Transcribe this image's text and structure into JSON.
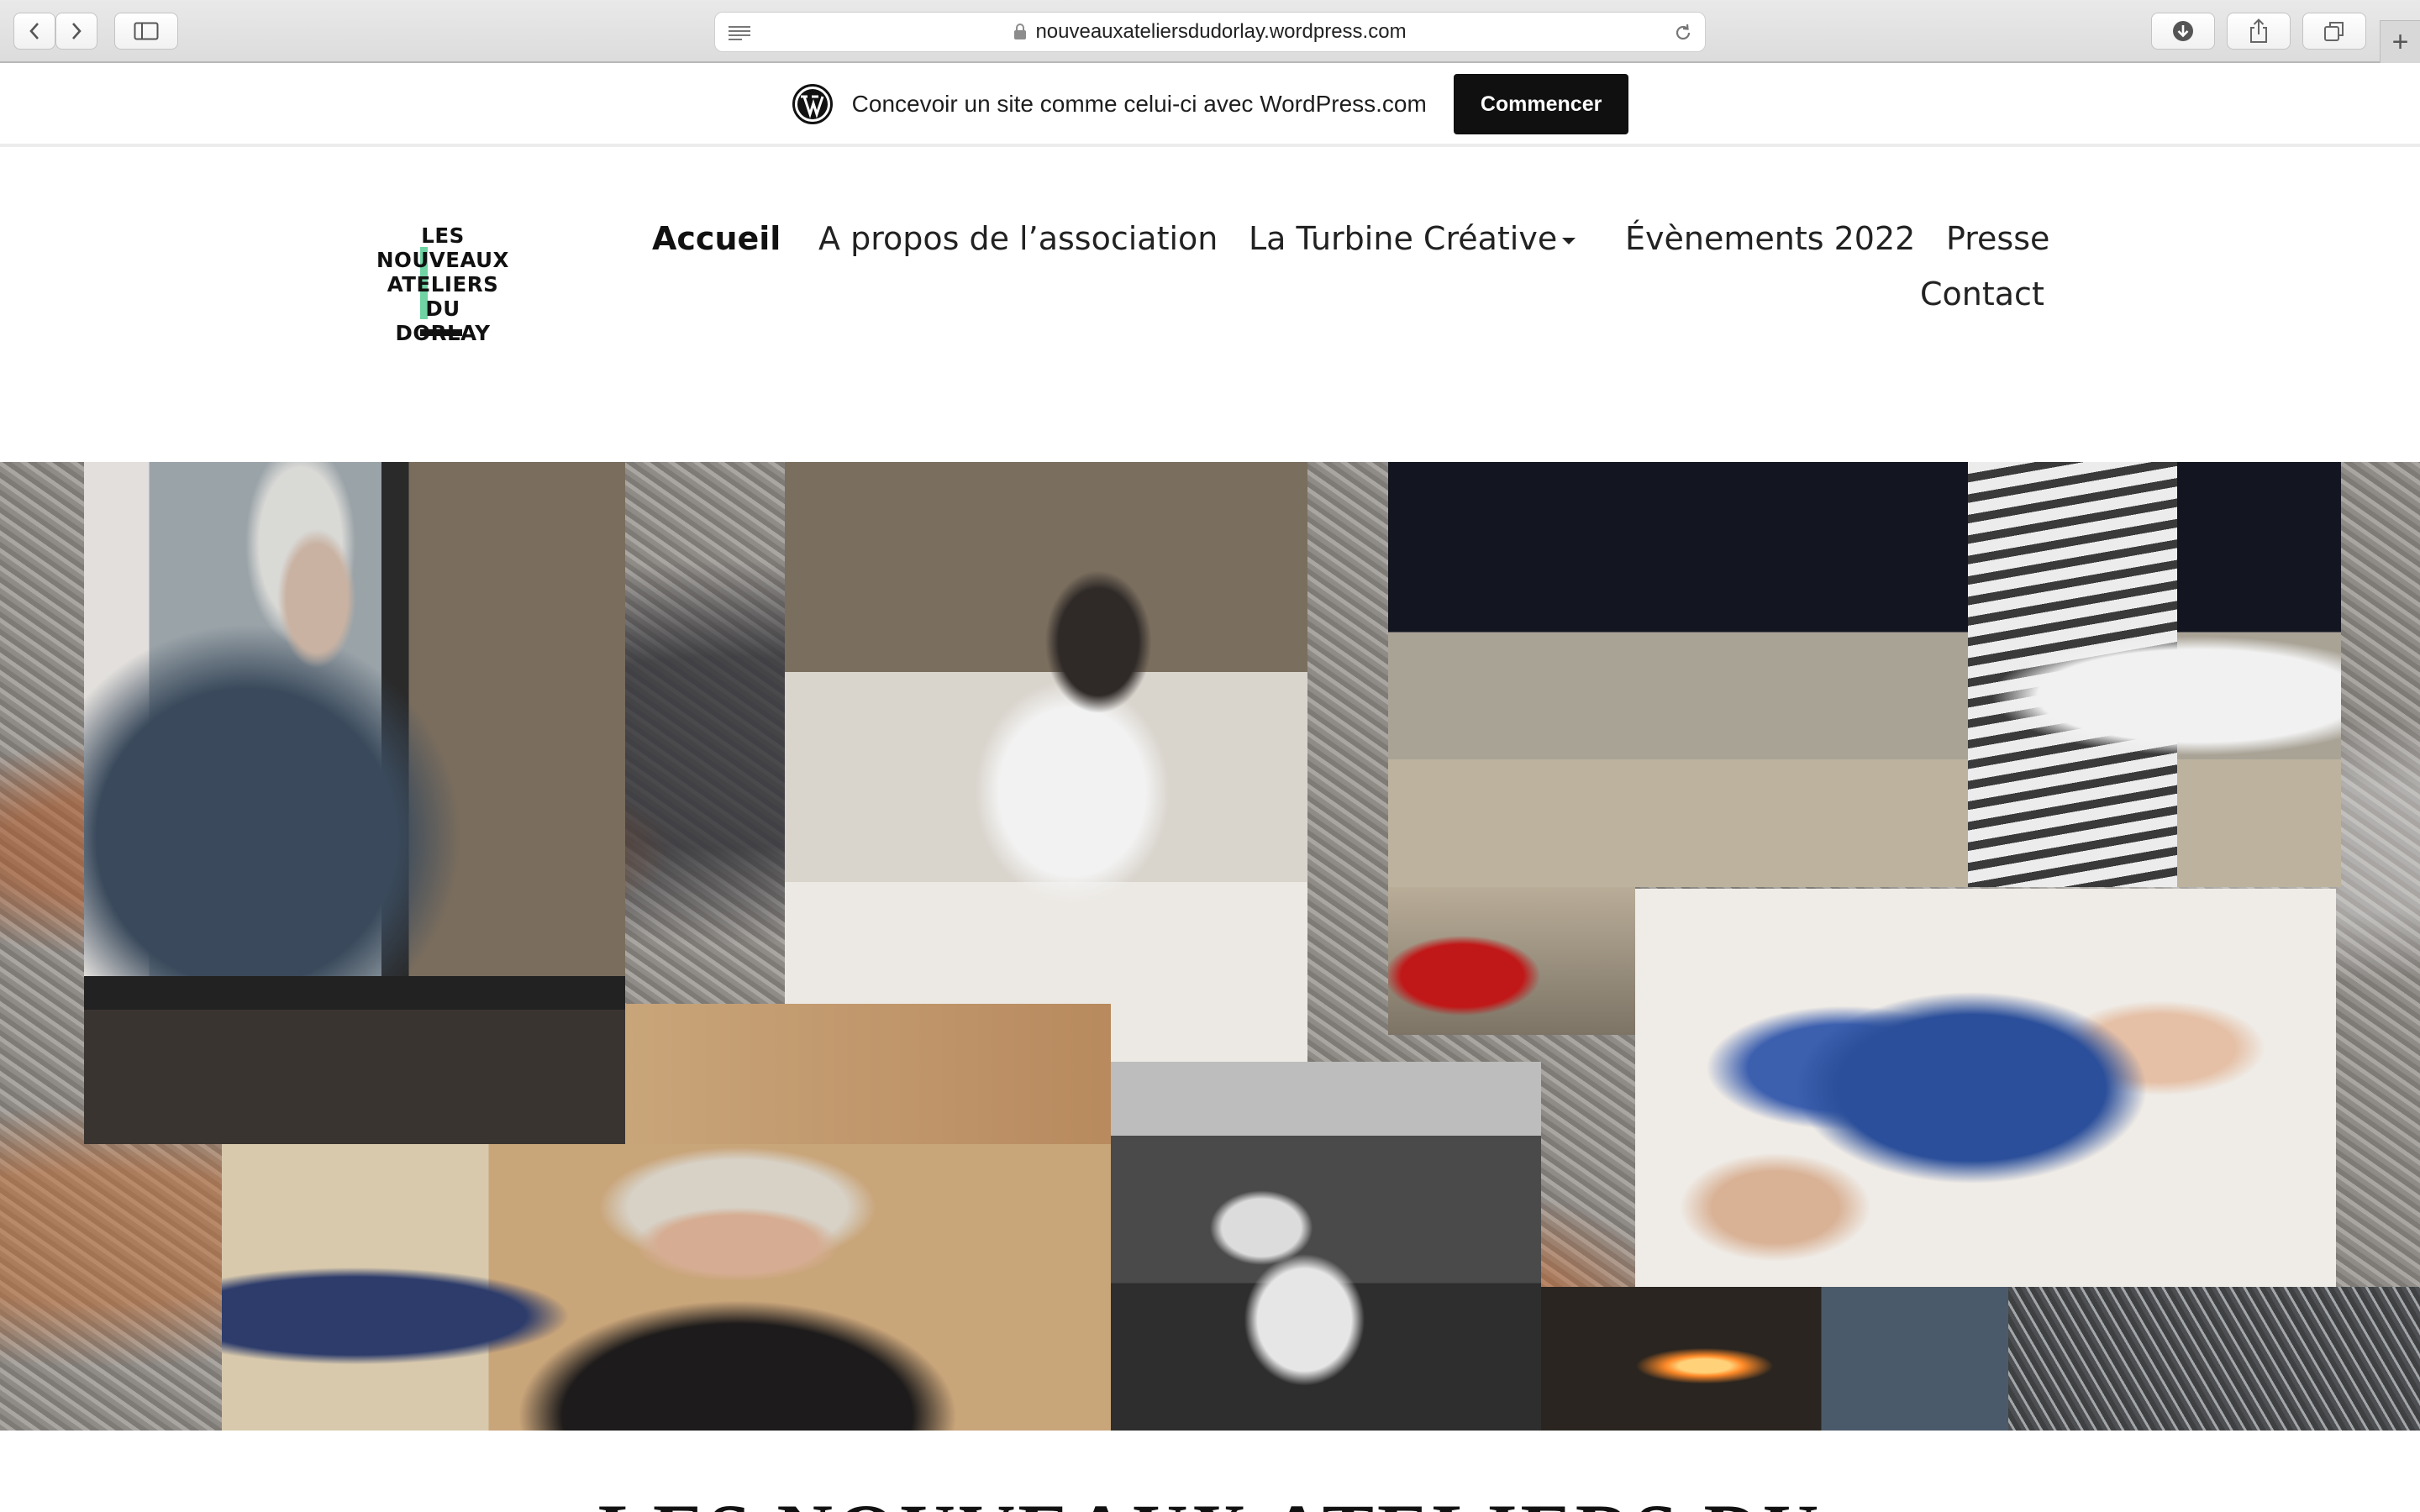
{
  "browser": {
    "url": "nouveauxateliersdudorlay.wordpress.com",
    "new_tab": "+"
  },
  "wp_banner": {
    "text": "Concevoir un site comme celui-ci avec WordPress.com",
    "button": "Commencer"
  },
  "site": {
    "logo_lines": [
      "LES",
      "NOUVEAUX",
      "ATELIERS",
      "DU DORLAY"
    ],
    "title": "LES NOUVEAUX ATELIERS DU"
  },
  "nav": {
    "items": [
      {
        "label": "Accueil"
      },
      {
        "label": "A propos de l’association"
      },
      {
        "label": "La Turbine Créative"
      },
      {
        "label": "Évènements 2022"
      },
      {
        "label": "Presse"
      },
      {
        "label": "Contact"
      }
    ]
  },
  "hero": {
    "photos": [
      "artisan-painting-glass",
      "artisan-painting-miniature",
      "hands-sewing-chair",
      "red-tool",
      "hands-blue-fabric",
      "milliner-smiling",
      "woodworker-bw",
      "glassblowing-flame",
      "wire-texture"
    ]
  }
}
